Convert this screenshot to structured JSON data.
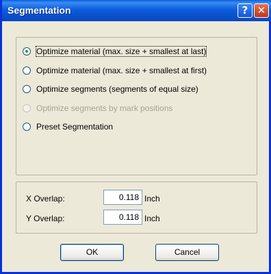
{
  "window": {
    "title": "Segmentation",
    "help_glyph": "?",
    "close_glyph": "✕"
  },
  "options": {
    "items": [
      {
        "label": "Optimize material (max. size + smallest at last)",
        "checked": true,
        "disabled": false
      },
      {
        "label": "Optimize material (max. size + smallest at first)",
        "checked": false,
        "disabled": false
      },
      {
        "label": "Optimize segments (segments of equal size)",
        "checked": false,
        "disabled": false
      },
      {
        "label": "Optimize segments by mark positions",
        "checked": false,
        "disabled": true
      },
      {
        "label": "Preset Segmentation",
        "checked": false,
        "disabled": false
      }
    ]
  },
  "overlap": {
    "x_label": "X Overlap:",
    "x_value": "0.118",
    "x_unit": "Inch",
    "y_label": "Y Overlap:",
    "y_value": "0.118",
    "y_unit": "Inch"
  },
  "buttons": {
    "ok": "OK",
    "cancel": "Cancel"
  },
  "colors": {
    "title_bar": "#0a5fd8",
    "dialog_bg": "#ece9d8",
    "close_button": "#c2351a"
  }
}
